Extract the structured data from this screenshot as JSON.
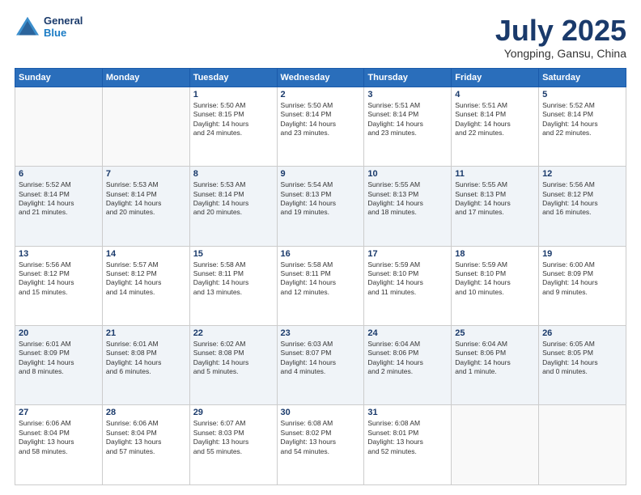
{
  "header": {
    "logo_line1": "General",
    "logo_line2": "Blue",
    "month": "July 2025",
    "location": "Yongping, Gansu, China"
  },
  "weekdays": [
    "Sunday",
    "Monday",
    "Tuesday",
    "Wednesday",
    "Thursday",
    "Friday",
    "Saturday"
  ],
  "weeks": [
    [
      {
        "day": "",
        "lines": []
      },
      {
        "day": "",
        "lines": []
      },
      {
        "day": "1",
        "lines": [
          "Sunrise: 5:50 AM",
          "Sunset: 8:15 PM",
          "Daylight: 14 hours",
          "and 24 minutes."
        ]
      },
      {
        "day": "2",
        "lines": [
          "Sunrise: 5:50 AM",
          "Sunset: 8:14 PM",
          "Daylight: 14 hours",
          "and 23 minutes."
        ]
      },
      {
        "day": "3",
        "lines": [
          "Sunrise: 5:51 AM",
          "Sunset: 8:14 PM",
          "Daylight: 14 hours",
          "and 23 minutes."
        ]
      },
      {
        "day": "4",
        "lines": [
          "Sunrise: 5:51 AM",
          "Sunset: 8:14 PM",
          "Daylight: 14 hours",
          "and 22 minutes."
        ]
      },
      {
        "day": "5",
        "lines": [
          "Sunrise: 5:52 AM",
          "Sunset: 8:14 PM",
          "Daylight: 14 hours",
          "and 22 minutes."
        ]
      }
    ],
    [
      {
        "day": "6",
        "lines": [
          "Sunrise: 5:52 AM",
          "Sunset: 8:14 PM",
          "Daylight: 14 hours",
          "and 21 minutes."
        ]
      },
      {
        "day": "7",
        "lines": [
          "Sunrise: 5:53 AM",
          "Sunset: 8:14 PM",
          "Daylight: 14 hours",
          "and 20 minutes."
        ]
      },
      {
        "day": "8",
        "lines": [
          "Sunrise: 5:53 AM",
          "Sunset: 8:14 PM",
          "Daylight: 14 hours",
          "and 20 minutes."
        ]
      },
      {
        "day": "9",
        "lines": [
          "Sunrise: 5:54 AM",
          "Sunset: 8:13 PM",
          "Daylight: 14 hours",
          "and 19 minutes."
        ]
      },
      {
        "day": "10",
        "lines": [
          "Sunrise: 5:55 AM",
          "Sunset: 8:13 PM",
          "Daylight: 14 hours",
          "and 18 minutes."
        ]
      },
      {
        "day": "11",
        "lines": [
          "Sunrise: 5:55 AM",
          "Sunset: 8:13 PM",
          "Daylight: 14 hours",
          "and 17 minutes."
        ]
      },
      {
        "day": "12",
        "lines": [
          "Sunrise: 5:56 AM",
          "Sunset: 8:12 PM",
          "Daylight: 14 hours",
          "and 16 minutes."
        ]
      }
    ],
    [
      {
        "day": "13",
        "lines": [
          "Sunrise: 5:56 AM",
          "Sunset: 8:12 PM",
          "Daylight: 14 hours",
          "and 15 minutes."
        ]
      },
      {
        "day": "14",
        "lines": [
          "Sunrise: 5:57 AM",
          "Sunset: 8:12 PM",
          "Daylight: 14 hours",
          "and 14 minutes."
        ]
      },
      {
        "day": "15",
        "lines": [
          "Sunrise: 5:58 AM",
          "Sunset: 8:11 PM",
          "Daylight: 14 hours",
          "and 13 minutes."
        ]
      },
      {
        "day": "16",
        "lines": [
          "Sunrise: 5:58 AM",
          "Sunset: 8:11 PM",
          "Daylight: 14 hours",
          "and 12 minutes."
        ]
      },
      {
        "day": "17",
        "lines": [
          "Sunrise: 5:59 AM",
          "Sunset: 8:10 PM",
          "Daylight: 14 hours",
          "and 11 minutes."
        ]
      },
      {
        "day": "18",
        "lines": [
          "Sunrise: 5:59 AM",
          "Sunset: 8:10 PM",
          "Daylight: 14 hours",
          "and 10 minutes."
        ]
      },
      {
        "day": "19",
        "lines": [
          "Sunrise: 6:00 AM",
          "Sunset: 8:09 PM",
          "Daylight: 14 hours",
          "and 9 minutes."
        ]
      }
    ],
    [
      {
        "day": "20",
        "lines": [
          "Sunrise: 6:01 AM",
          "Sunset: 8:09 PM",
          "Daylight: 14 hours",
          "and 8 minutes."
        ]
      },
      {
        "day": "21",
        "lines": [
          "Sunrise: 6:01 AM",
          "Sunset: 8:08 PM",
          "Daylight: 14 hours",
          "and 6 minutes."
        ]
      },
      {
        "day": "22",
        "lines": [
          "Sunrise: 6:02 AM",
          "Sunset: 8:08 PM",
          "Daylight: 14 hours",
          "and 5 minutes."
        ]
      },
      {
        "day": "23",
        "lines": [
          "Sunrise: 6:03 AM",
          "Sunset: 8:07 PM",
          "Daylight: 14 hours",
          "and 4 minutes."
        ]
      },
      {
        "day": "24",
        "lines": [
          "Sunrise: 6:04 AM",
          "Sunset: 8:06 PM",
          "Daylight: 14 hours",
          "and 2 minutes."
        ]
      },
      {
        "day": "25",
        "lines": [
          "Sunrise: 6:04 AM",
          "Sunset: 8:06 PM",
          "Daylight: 14 hours",
          "and 1 minute."
        ]
      },
      {
        "day": "26",
        "lines": [
          "Sunrise: 6:05 AM",
          "Sunset: 8:05 PM",
          "Daylight: 14 hours",
          "and 0 minutes."
        ]
      }
    ],
    [
      {
        "day": "27",
        "lines": [
          "Sunrise: 6:06 AM",
          "Sunset: 8:04 PM",
          "Daylight: 13 hours",
          "and 58 minutes."
        ]
      },
      {
        "day": "28",
        "lines": [
          "Sunrise: 6:06 AM",
          "Sunset: 8:04 PM",
          "Daylight: 13 hours",
          "and 57 minutes."
        ]
      },
      {
        "day": "29",
        "lines": [
          "Sunrise: 6:07 AM",
          "Sunset: 8:03 PM",
          "Daylight: 13 hours",
          "and 55 minutes."
        ]
      },
      {
        "day": "30",
        "lines": [
          "Sunrise: 6:08 AM",
          "Sunset: 8:02 PM",
          "Daylight: 13 hours",
          "and 54 minutes."
        ]
      },
      {
        "day": "31",
        "lines": [
          "Sunrise: 6:08 AM",
          "Sunset: 8:01 PM",
          "Daylight: 13 hours",
          "and 52 minutes."
        ]
      },
      {
        "day": "",
        "lines": []
      },
      {
        "day": "",
        "lines": []
      }
    ]
  ]
}
